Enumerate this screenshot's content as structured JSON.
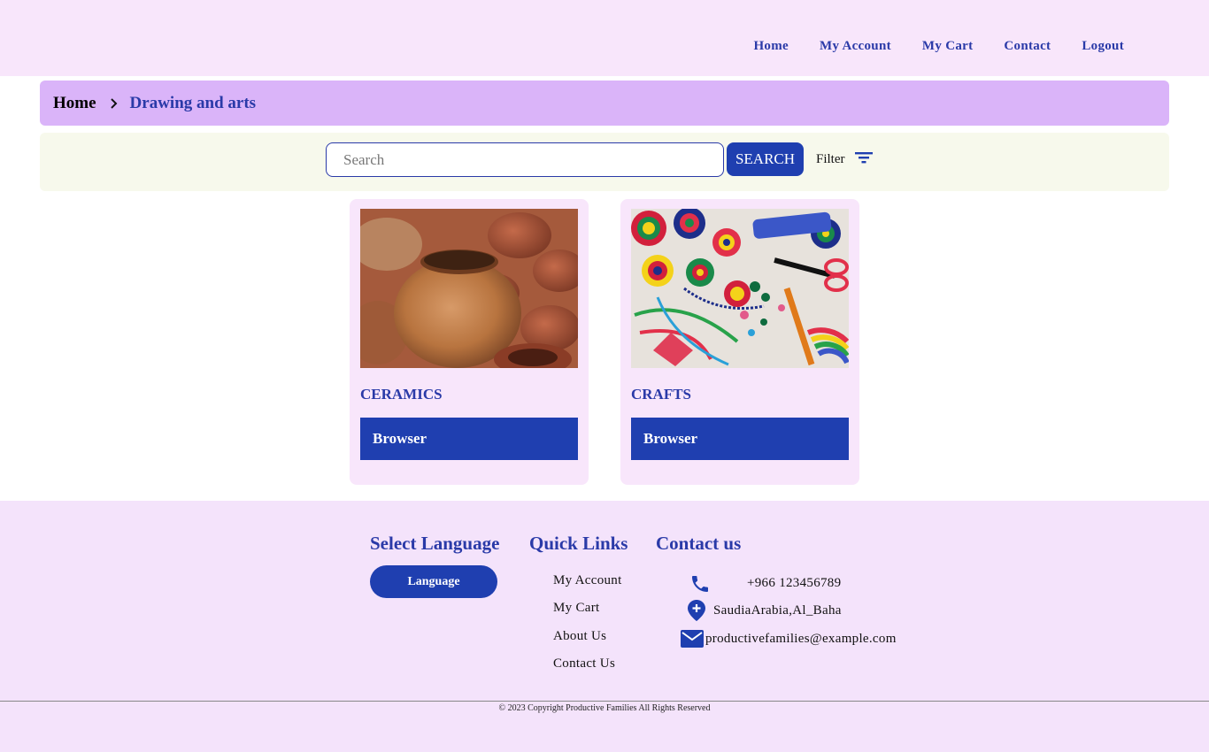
{
  "nav": {
    "links": [
      "Home",
      "My Account",
      "My Cart",
      "Contact",
      "Logout"
    ]
  },
  "breadcrumb": {
    "home": "Home",
    "current": "Drawing and arts"
  },
  "search": {
    "placeholder": "Search",
    "value": "",
    "button_label": "SEARCH",
    "filter_label": "Filter"
  },
  "cards": [
    {
      "title": "CERAMICS",
      "button_label": "Browser",
      "image": "clay-pots-photo"
    },
    {
      "title": "CRAFTS",
      "button_label": "Browser",
      "image": "craft-supplies-photo"
    }
  ],
  "footer": {
    "language": {
      "heading": "Select Language",
      "button_label": "Language"
    },
    "quick_links": {
      "heading": "Quick Links",
      "items": [
        "My Account",
        "My Cart",
        "About Us",
        "Contact Us"
      ]
    },
    "contact": {
      "heading": "Contact us",
      "phone": "+966 123456789",
      "location": "SaudiaArabia,Al_Baha",
      "email": "productivefamilies@example.com"
    },
    "copyright": "© 2023 Copyright Productive Families All Rights Reserved"
  },
  "colors": {
    "primary": "#1f3fb0",
    "link": "#2a3aa8",
    "nav_bg": "#f8e6fb",
    "breadcrumb_bg": "#dab4f9",
    "footer_bg": "#f4e3fb"
  }
}
